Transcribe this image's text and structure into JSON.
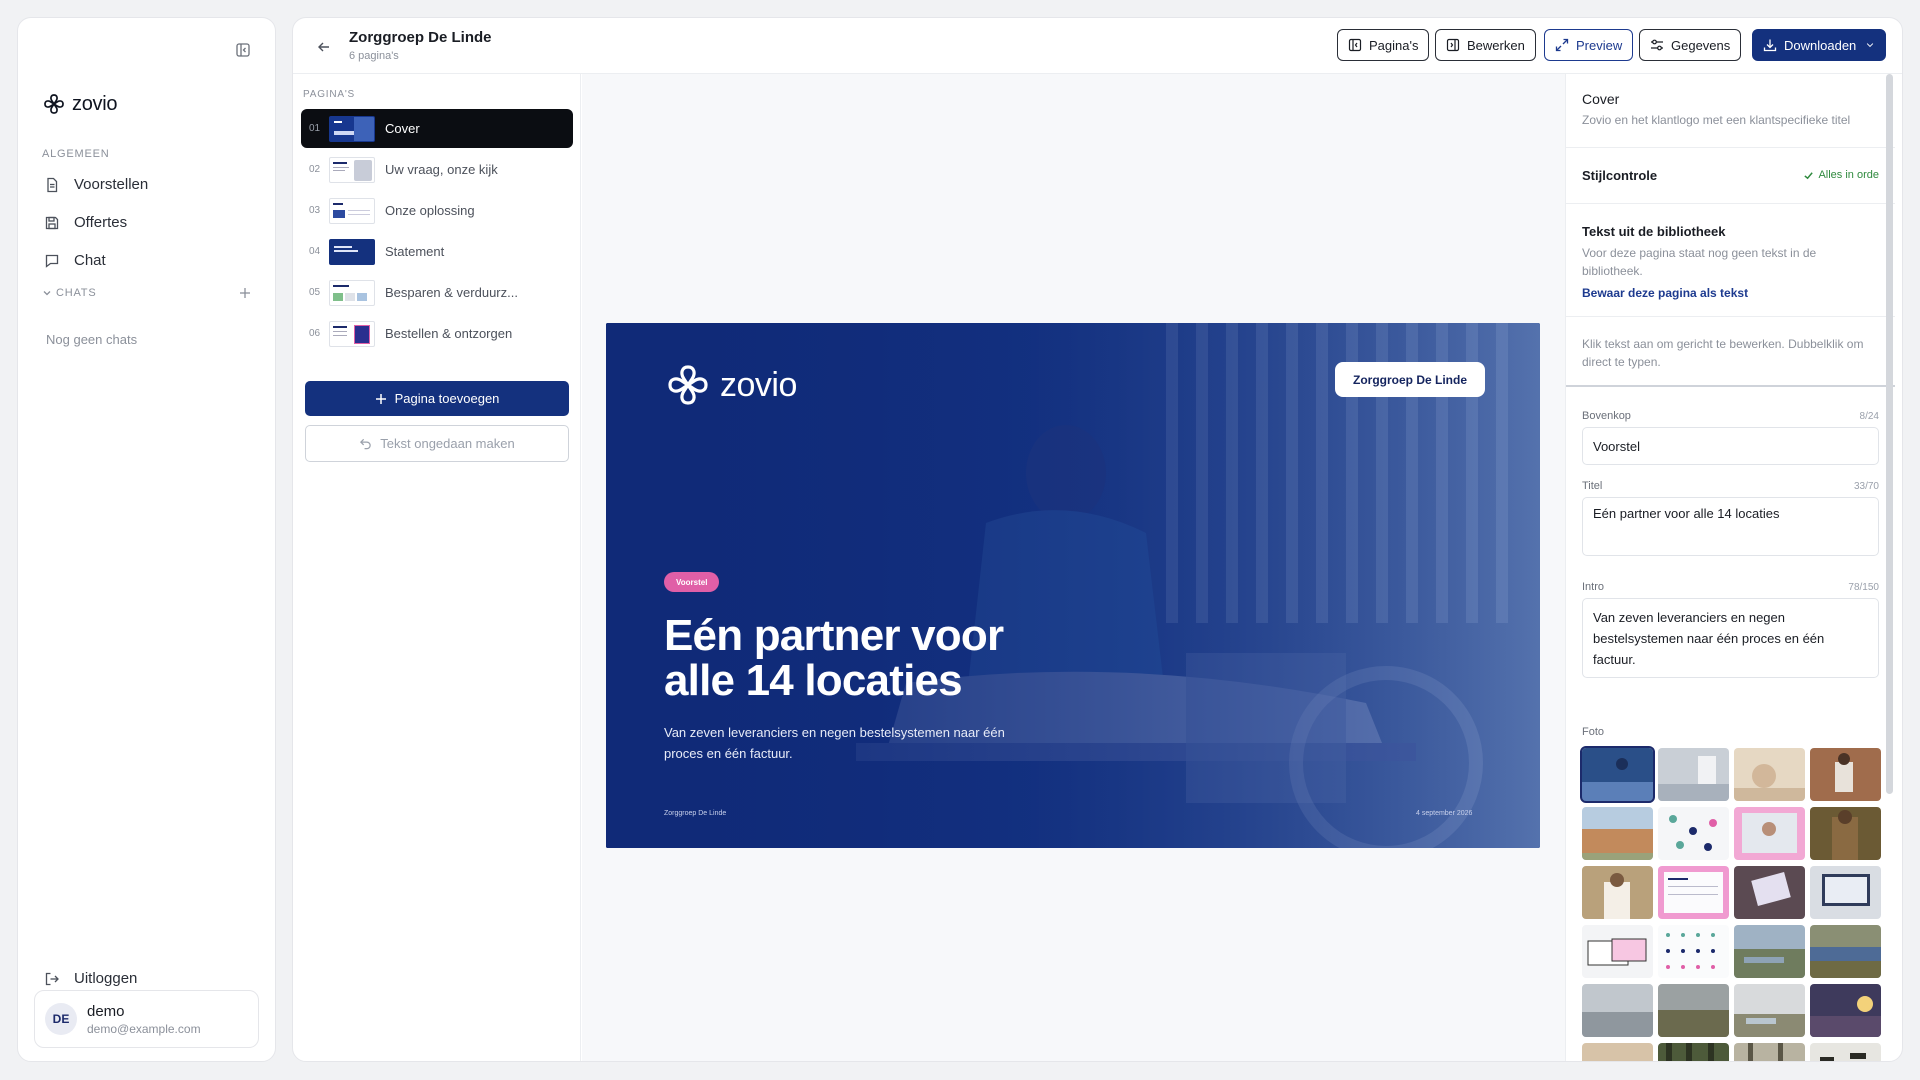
{
  "sidebar": {
    "brand": "zovio",
    "section_general": "ALGEMEEN",
    "nav": [
      {
        "label": "Voorstellen",
        "icon": "document-icon"
      },
      {
        "label": "Offertes",
        "icon": "save-icon"
      },
      {
        "label": "Chat",
        "icon": "chat-icon"
      }
    ],
    "section_chats": "CHATS",
    "no_chats": "Nog geen chats",
    "logout": "Uitloggen",
    "user": {
      "initials": "DE",
      "name": "demo",
      "email": "demo@example.com"
    }
  },
  "topbar": {
    "title": "Zorggroep De Linde",
    "subtitle": "6 pagina's",
    "buttons": {
      "pages": "Pagina's",
      "edit": "Bewerken",
      "preview": "Preview",
      "data": "Gegevens",
      "download": "Downloaden"
    }
  },
  "pages_panel": {
    "label": "PAGINA'S",
    "pages": [
      {
        "num": "01",
        "name": "Cover"
      },
      {
        "num": "02",
        "name": "Uw vraag, onze kijk"
      },
      {
        "num": "03",
        "name": "Onze oplossing"
      },
      {
        "num": "04",
        "name": "Statement"
      },
      {
        "num": "05",
        "name": "Besparen & verduurz..."
      },
      {
        "num": "06",
        "name": "Bestellen & ontzorgen"
      }
    ],
    "active_index": 0,
    "add_button": "Pagina toevoegen",
    "undo_button": "Tekst ongedaan maken"
  },
  "slide": {
    "brand": "zovio",
    "client": "Zorggroep De Linde",
    "tag": "Voorstel",
    "title": "Eén partner voor alle 14 locaties",
    "intro": "Van zeven leveranciers en negen bestelsystemen naar één proces en één factuur.",
    "footer_left": "Zorggroep De Linde",
    "footer_right": "4 september 2026",
    "colors": {
      "base": "#102a78",
      "tag": "#e05fa7"
    }
  },
  "properties": {
    "page_title": "Cover",
    "page_desc": "Zovio en het klantlogo met een klantspecifieke titel",
    "style_check": "Stijlcontrole",
    "style_ok": "Alles in orde",
    "library_title": "Tekst uit de bibliotheek",
    "library_desc": "Voor deze pagina staat nog geen tekst in de bibliotheek.",
    "library_link": "Bewaar deze pagina als tekst",
    "hint": "Klik tekst aan om gericht te bewerken. Dubbelklik om direct te typen.",
    "fields": {
      "bovenkop": {
        "label": "Bovenkop",
        "count": "8/24",
        "value": "Voorstel"
      },
      "titel": {
        "label": "Titel",
        "count": "33/70",
        "value": "Eén partner voor alle 14 locaties"
      },
      "intro": {
        "label": "Intro",
        "count": "78/150",
        "value": "Van zeven leveranciers en negen bestelsystemen naar één proces en één factuur."
      }
    },
    "photo_label": "Foto",
    "photo_count": 24,
    "photo_selected_index": 0
  }
}
